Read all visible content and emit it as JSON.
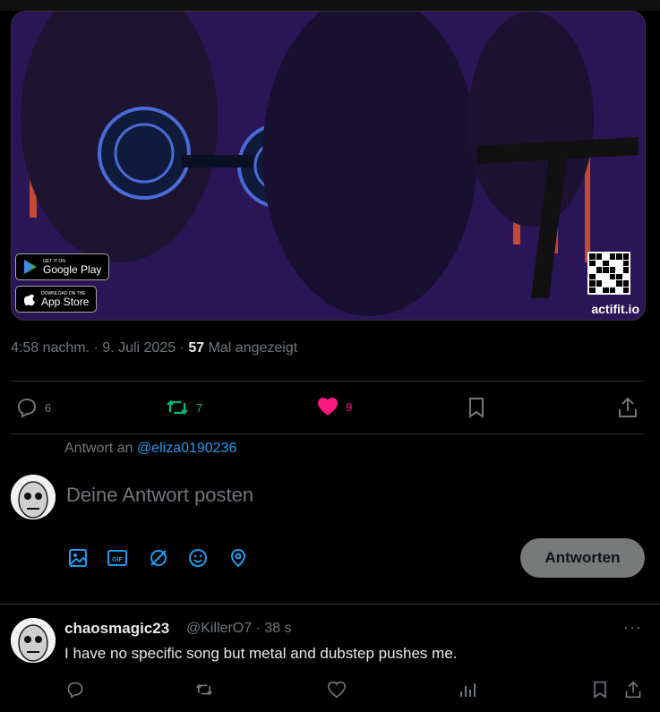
{
  "media": {
    "google_play_small": "GET IT ON",
    "google_play_big": "Google Play",
    "app_store_small": "Download on the",
    "app_store_big": "App Store",
    "site": "actifit.io"
  },
  "meta": {
    "time": "4:58 nachm. · 9. Juli 2025 · ",
    "views": "57",
    "views_label": " Mal angezeigt"
  },
  "actions": {
    "replies": "6",
    "retweets": "7",
    "likes": "9"
  },
  "compose": {
    "reply_to_label": "Antwort an ",
    "reply_to_handle": "@eliza0190236",
    "placeholder": "Deine Antwort posten",
    "submit": "Antworten"
  },
  "reply_tweet": {
    "name": "chaosmagic23",
    "handle": "@KillerO7 · 38 s",
    "text": "I have no specific song but metal and dubstep pushes me.",
    "more": "···"
  },
  "colors": {
    "accent": "#1d9bf0",
    "retweet": "#00ba7c",
    "like": "#f91880",
    "muted": "#71767b"
  }
}
